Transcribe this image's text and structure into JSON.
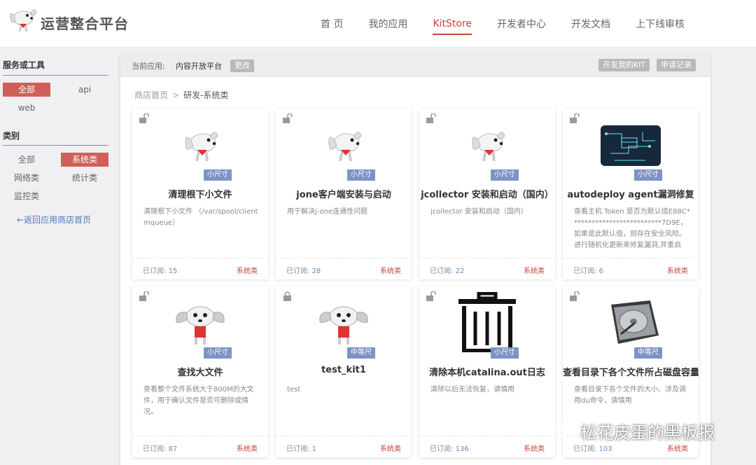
{
  "app": {
    "title": "运营整合平台"
  },
  "nav": [
    {
      "label": "首 页",
      "active": false
    },
    {
      "label": "我的应用",
      "active": false
    },
    {
      "label": "KitStore",
      "active": true
    },
    {
      "label": "开发者中心",
      "active": false
    },
    {
      "label": "开发文档",
      "active": false
    },
    {
      "label": "上下线审核",
      "active": false
    }
  ],
  "sidebar": {
    "service_heading": "服务或工具",
    "service_items": [
      "全部",
      "api",
      "web"
    ],
    "category_heading": "类别",
    "category_items": [
      "全部",
      "系统类",
      "网络类",
      "统计类",
      "监控类"
    ],
    "back_link": "←返回应用商店首页"
  },
  "toolbar": {
    "current_label": "当前应用:",
    "current_value": "内容开放平台",
    "change_label": "更改",
    "develop_label": "开发我的KIT",
    "records_label": "申请记录"
  },
  "breadcrumb": {
    "home": "商店首页",
    "sep": ">",
    "current": "研发-系统类"
  },
  "subscribed_label": "已订阅:",
  "cards": [
    {
      "title": "清理根下小文件",
      "desc": "清理根下小文件 （/var/spool/clientmqueue）",
      "size": "小尺寸",
      "count": "15",
      "category": "系统类",
      "thumb": "mascot-icon",
      "locked": false
    },
    {
      "title": "jone客户端安装与启动",
      "desc": "用于解决j-one连通性问题",
      "size": "小尺寸",
      "count": "28",
      "category": "系统类",
      "thumb": "mascot-icon",
      "locked": false
    },
    {
      "title": "jcollector 安装和启动（国内）",
      "desc": "jcollector 安装和启动（国内）",
      "size": "小尺寸",
      "count": "22",
      "category": "系统类",
      "thumb": "mascot-icon",
      "locked": false
    },
    {
      "title": "autodeploy agent漏洞修复",
      "desc": "查看主机 Token 是否为默认值E88C**************************7D9E，如果是此默认值，则存在安全风险。进行随机化更新来修复漏洞,并重启",
      "size": "小尺寸",
      "count": "6",
      "category": "系统类",
      "thumb": "circuit-image",
      "locked": false
    },
    {
      "title": "查找大文件",
      "desc": "查看整个文件系统大于800M的大文件，用于确认文件是否可删除或情况。",
      "size": "小尺寸",
      "count": "87",
      "category": "系统类",
      "thumb": "mascot-shirt-icon",
      "locked": false
    },
    {
      "title": "test_kit1",
      "desc": "test",
      "size": "中等尺",
      "count": "1",
      "category": "系统类",
      "thumb": "mascot-shirt-icon",
      "locked": true
    },
    {
      "title": "清除本机catalina.out日志",
      "desc": "清除以后无法恢复，请慎用",
      "size": "小尺寸",
      "count": "136",
      "category": "系统类",
      "thumb": "trash-icon",
      "locked": false
    },
    {
      "title": "查看目录下各个文件所占磁盘容量",
      "desc": "查看目录下各个文件的大小、涉及调用du命令，请慎用",
      "size": "中等尺",
      "count": "103",
      "category": "系统类",
      "thumb": "harddisk-image",
      "locked": false
    }
  ],
  "colors": {
    "accent": "#c9433a",
    "badge": "#7d93c4",
    "count": "#5a8fcc"
  },
  "watermark": "松花皮蛋的黑板报"
}
